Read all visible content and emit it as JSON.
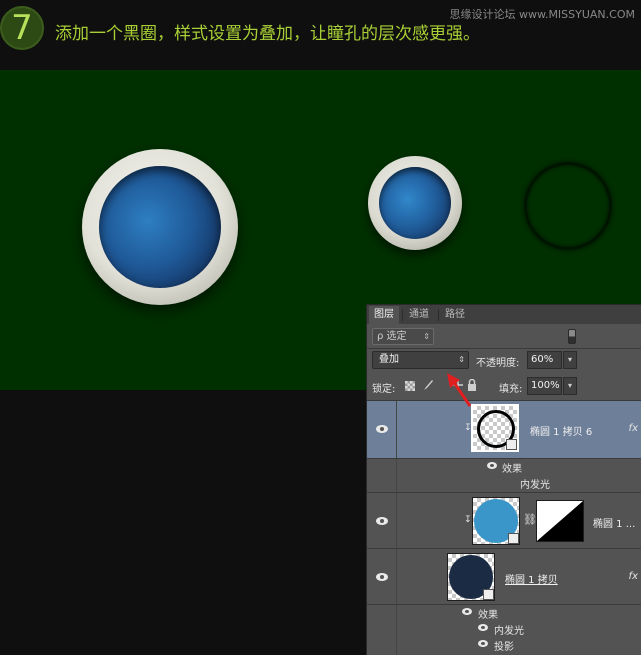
{
  "header": {
    "step_number": "7",
    "instruction": "添加一个黑圈，样式设置为叠加，让瞳孔的层次感更强。",
    "watermark": "思缘设计论坛 www.MISSYUAN.COM"
  },
  "panel": {
    "tabs": [
      {
        "label": "图层",
        "active": true
      },
      {
        "label": "通道",
        "active": false
      },
      {
        "label": "路径",
        "active": false
      }
    ],
    "filter": {
      "label": "ρ 选定",
      "arrows": "⇕"
    },
    "blend_mode": {
      "value": "叠加",
      "arrows": "⇕"
    },
    "opacity": {
      "label": "不透明度:",
      "value": "60%",
      "dropdown": "▾"
    },
    "lock": {
      "label": "锁定:"
    },
    "fill": {
      "label": "填充:",
      "value": "100%",
      "dropdown": "▾"
    },
    "layers": [
      {
        "name": "椭圆 1 拷贝 6",
        "selected": true,
        "fx": "fx",
        "clip": "↧",
        "effects_label": "效果",
        "effects": [
          "内发光"
        ]
      },
      {
        "name": "椭圆 1 ...",
        "selected": false,
        "clip": "↧",
        "link": "⛓",
        "thumb_color": "#3a95c9"
      },
      {
        "name": "椭圆 1 拷贝",
        "selected": false,
        "fx": "fx",
        "thumb_color": "#1b2b44",
        "effects_label": "效果",
        "effects": [
          "内发光",
          "投影"
        ]
      }
    ]
  },
  "colors": {
    "canvas_green": "#003000",
    "step_text": "#a8cf35",
    "selected_layer": "#6e7f99",
    "annotation_arrow": "#e02020"
  }
}
